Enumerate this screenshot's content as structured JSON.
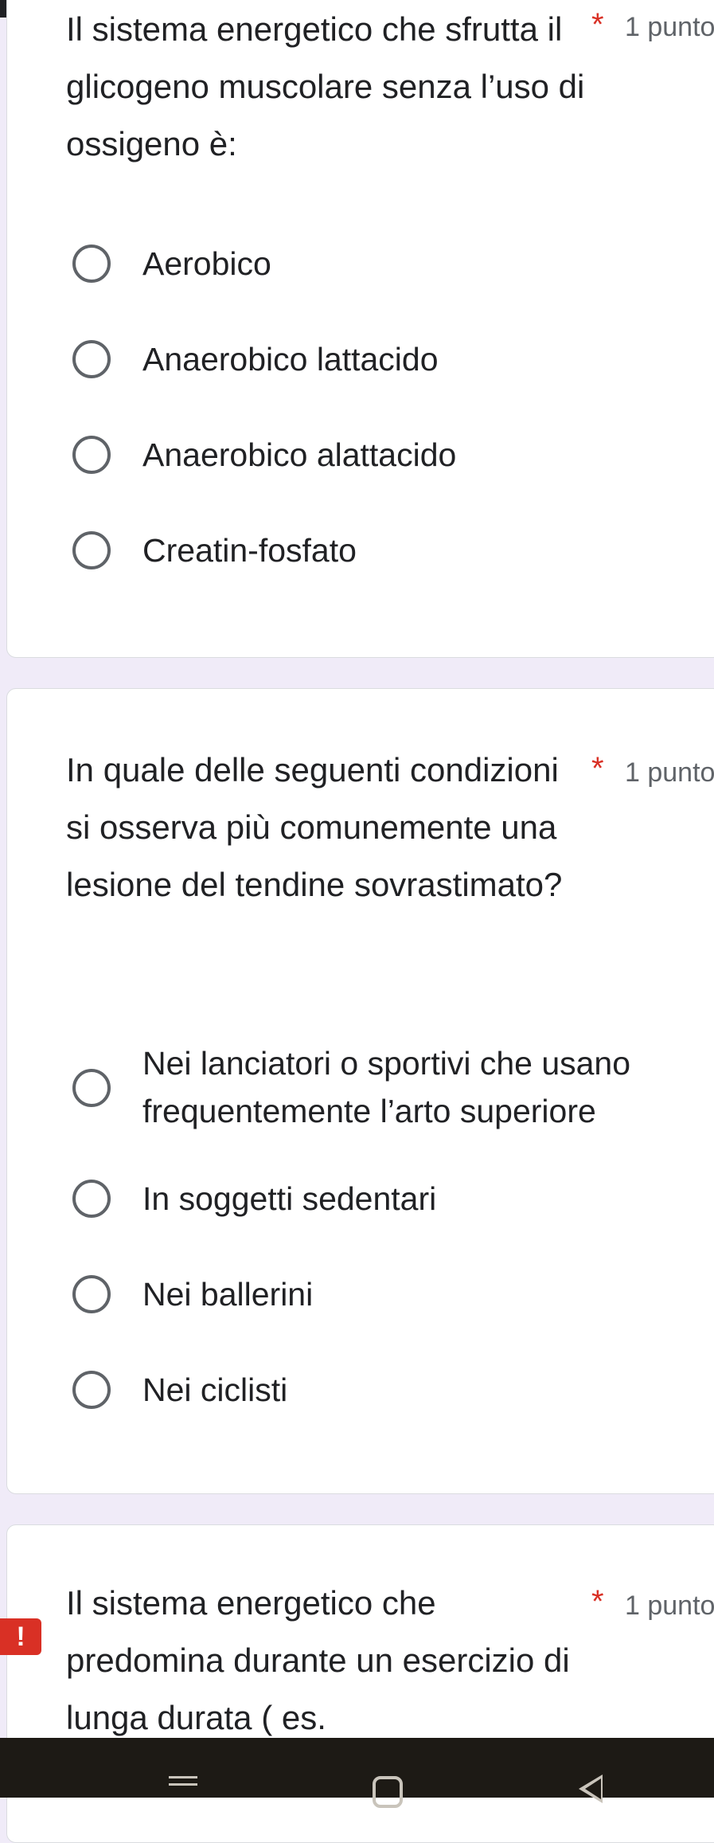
{
  "questions": [
    {
      "text": "Il sistema energetico che sfrutta il glicogeno muscolare senza l’uso di ossigeno è:",
      "required_mark": "*",
      "points": "1 punto",
      "options": [
        "Aerobico",
        "Anaerobico lattacido",
        "Anaerobico alattacido",
        "Creatin-fosfato"
      ]
    },
    {
      "text": "In quale delle seguenti condizioni si osserva più comunemente una lesione del tendine sovrastimato?",
      "required_mark": "*",
      "points": "1 punto",
      "options": [
        "Nei lanciatori o sportivi che usano frequentemente l’arto superiore",
        "In soggetti sedentari",
        "Nei ballerini",
        "Nei ciclisti"
      ]
    },
    {
      "text": "Il sistema energetico che predomina durante un esercizio di lunga durata ( es.",
      "required_mark": "*",
      "points": "1 punto"
    }
  ],
  "error_badge": "!",
  "colors": {
    "background": "#f0ebf8",
    "required": "#d93025",
    "radio_border": "#5f6368"
  },
  "nav_icons": [
    "menu-icon",
    "home-icon",
    "back-icon"
  ]
}
